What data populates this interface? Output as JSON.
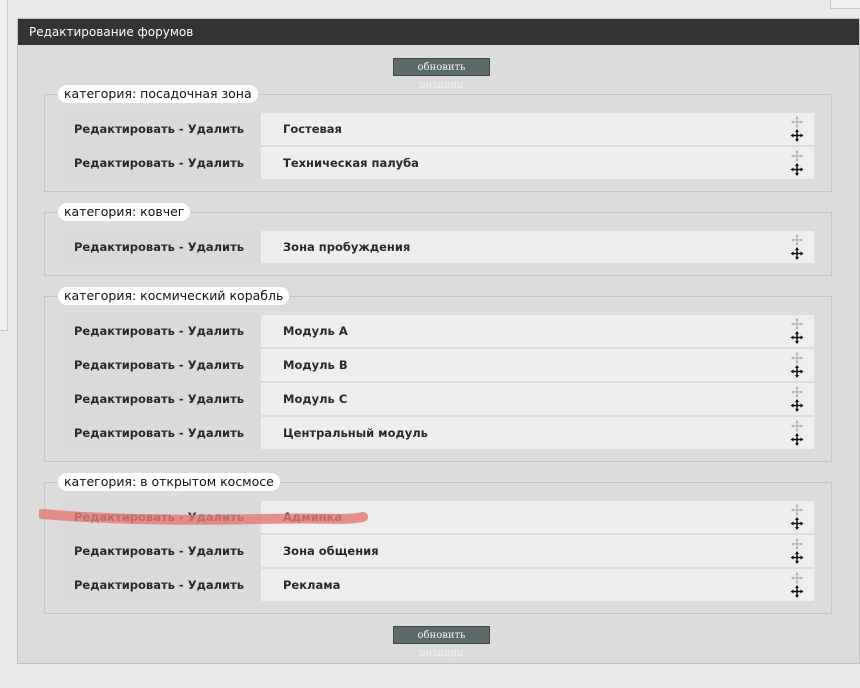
{
  "panel": {
    "title": "Редактирование форумов"
  },
  "buttons": {
    "update_top": "обновить позиции",
    "update_bottom": "обновить позиции"
  },
  "labels": {
    "edit": "Редактировать",
    "sep": " - ",
    "delete": "Удалить"
  },
  "categories": [
    {
      "legend": "категория: посадочная зона",
      "forums": [
        "Гостевая",
        "Техническая палуба"
      ]
    },
    {
      "legend": "категория: ковчег",
      "forums": [
        "Зона пробуждения"
      ]
    },
    {
      "legend": "категория: космический корабль",
      "forums": [
        "Модуль A",
        "Модуль B",
        "Модуль C",
        "Центральный модуль"
      ]
    },
    {
      "legend": "категория: в открытом космосе",
      "forums": [
        "Админка",
        "Зона общения",
        "Реклама"
      ]
    }
  ],
  "icons": {
    "drag": "move-arrows-icon"
  },
  "colors": {
    "header_bg": "#333333",
    "button_bg": "#5d6a6a",
    "highlight_stroke": "#e07b78"
  }
}
